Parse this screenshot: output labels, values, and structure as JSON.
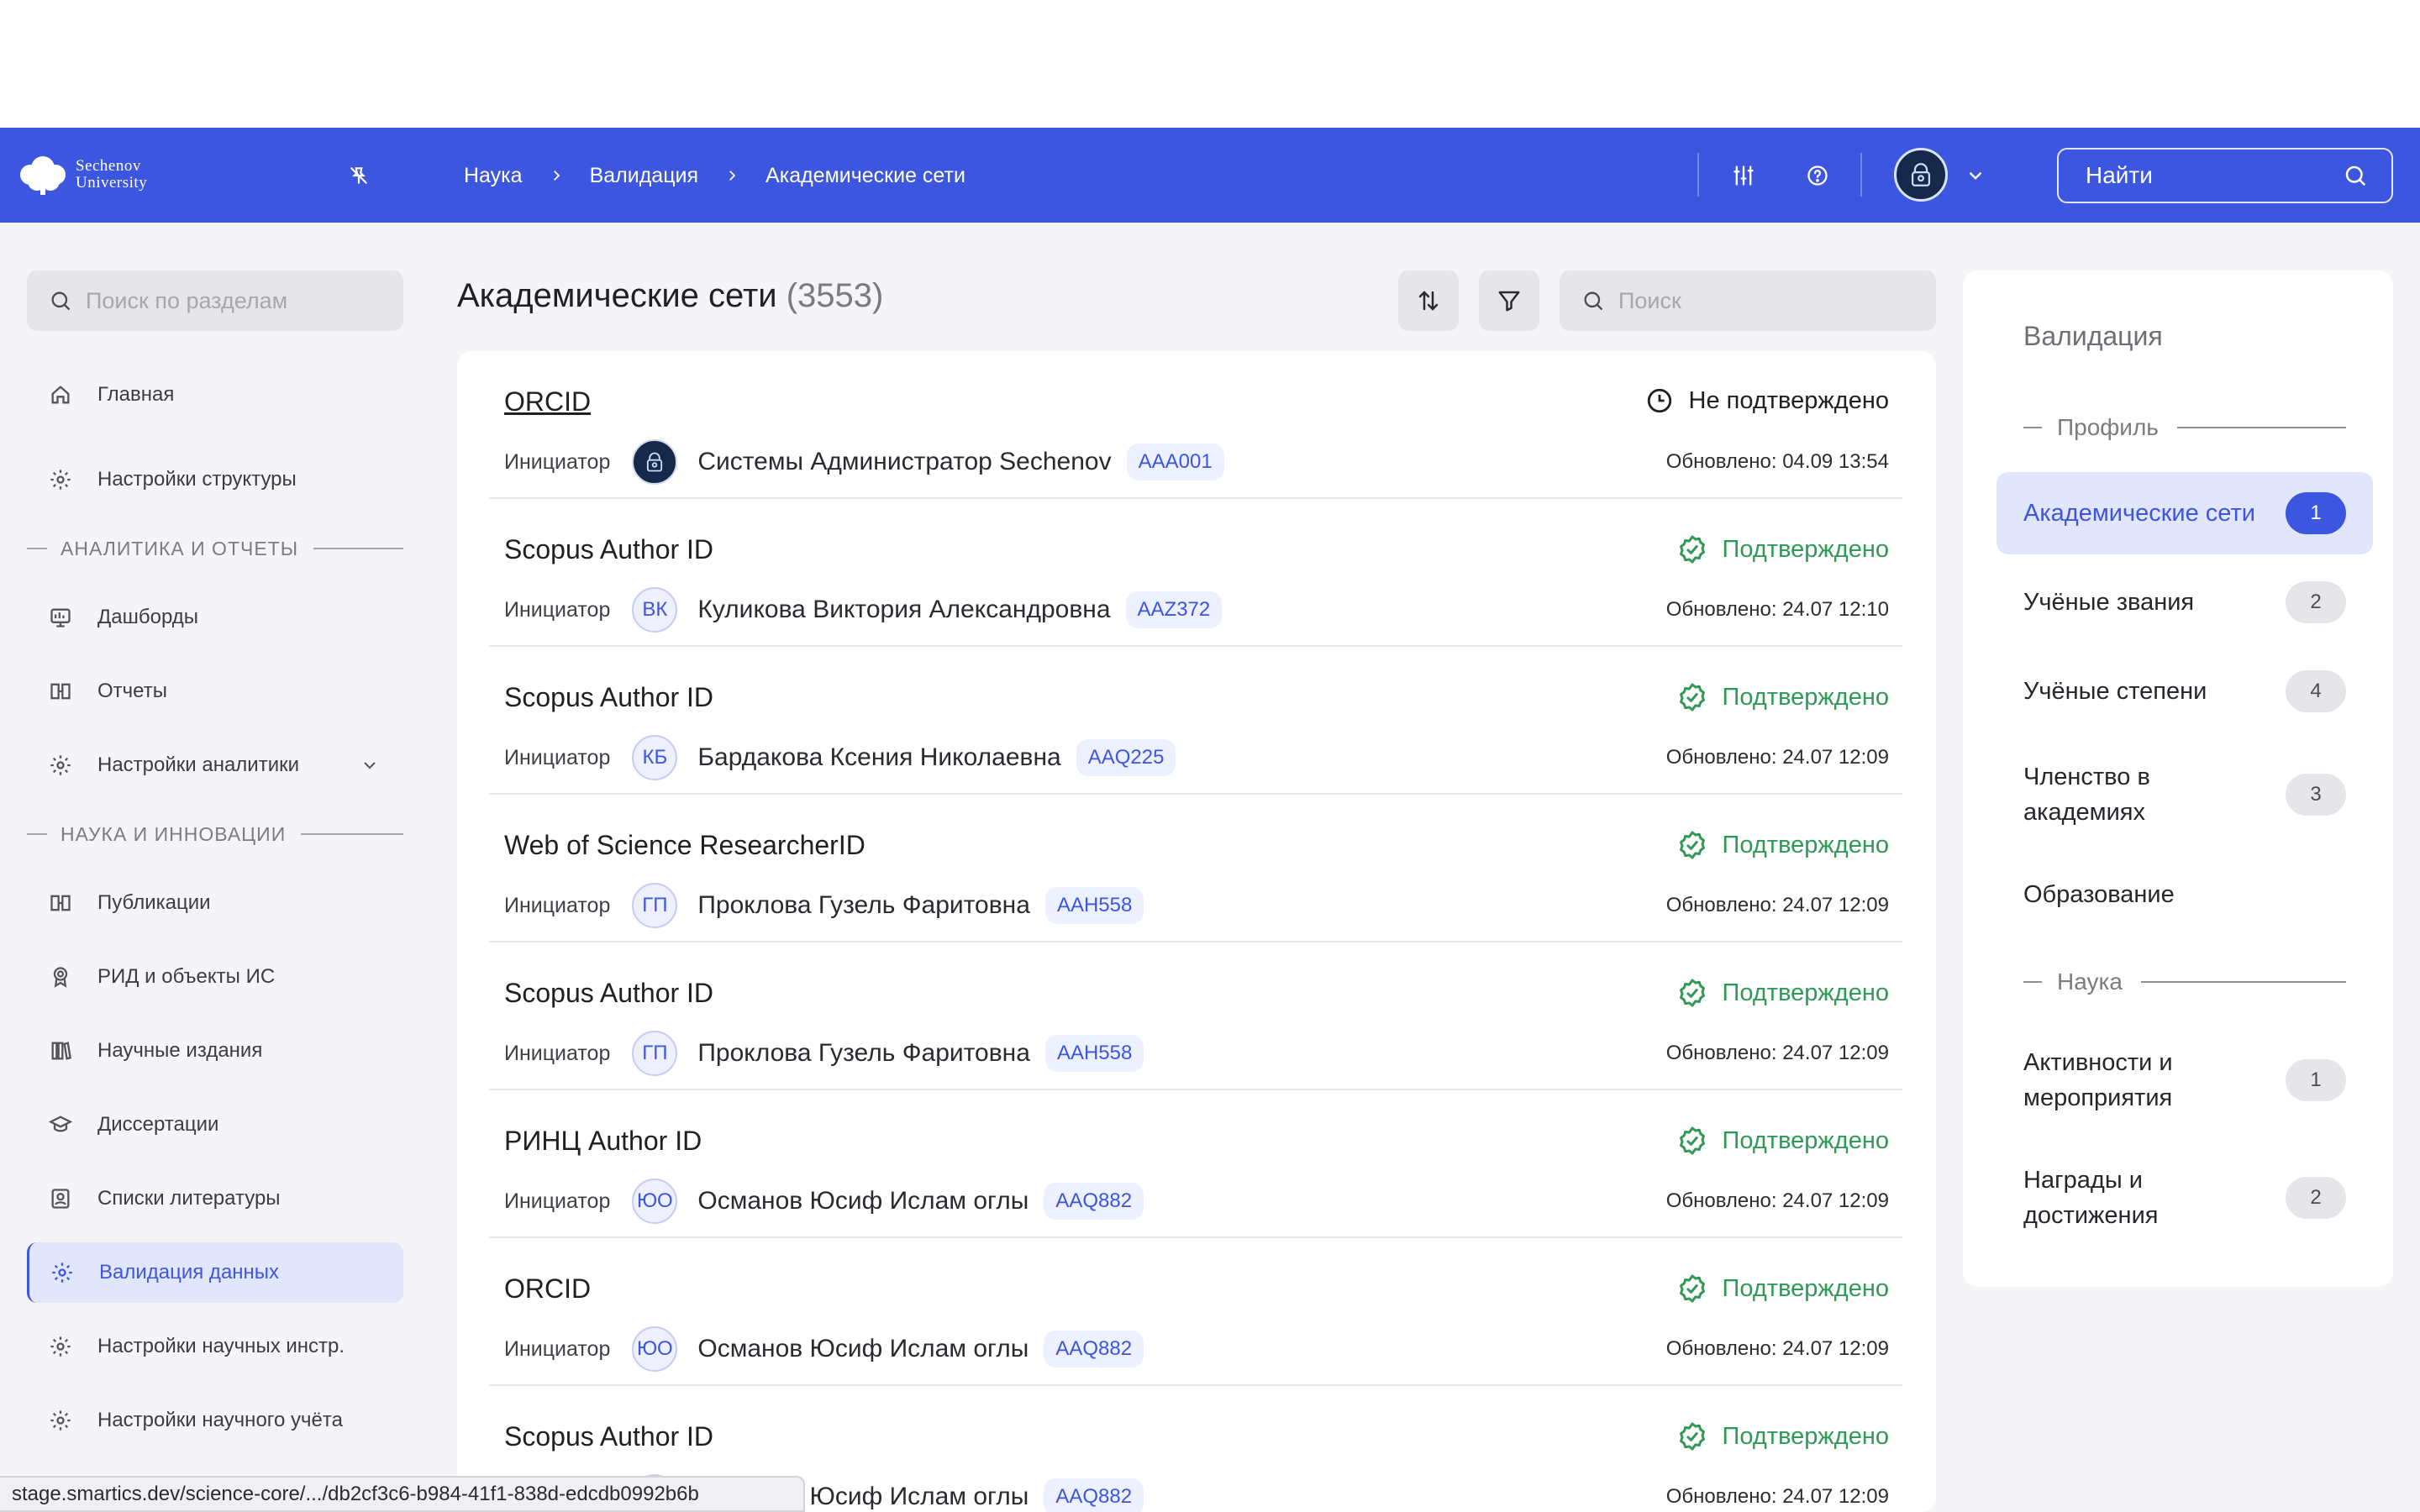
{
  "brand": {
    "line1": "Sechenov",
    "line2": "University"
  },
  "breadcrumb": [
    "Наука",
    "Валидация",
    "Академические сети"
  ],
  "header_search": {
    "label": "Найти"
  },
  "sidebar": {
    "search_placeholder": "Поиск по разделам",
    "items": {
      "home": "Главная",
      "structure": "Настройки структуры",
      "dashboards": "Дашборды",
      "reports": "Отчеты",
      "analytics_settings": "Настройки аналитики",
      "publications": "Публикации",
      "rid": "РИД и объекты ИС",
      "journals": "Научные издания",
      "dissertations": "Диссертации",
      "literature": "Списки литературы",
      "validation": "Валидация данных",
      "sci_instr": "Настройки научных инстр.",
      "sci_acc": "Настройки научного учёта"
    },
    "sections": {
      "analytics": "АНАЛИТИКА И ОТЧЕТЫ",
      "science": "НАУКА И ИННОВАЦИИ"
    }
  },
  "main": {
    "title": "Академические сети",
    "count": "(3553)",
    "search_placeholder": "Поиск",
    "initiator_label": "Инициатор",
    "rows": [
      {
        "title": "ORCID",
        "initials": "",
        "name": "Системы Администратор Sechenov",
        "code": "AAA001",
        "status": "Не подтверждено",
        "updated": "Обновлено: 04.09 13:54"
      },
      {
        "title": "Scopus Author ID",
        "initials": "ВК",
        "name": "Куликова Виктория Александровна",
        "code": "AAZ372",
        "status": "Подтверждено",
        "updated": "Обновлено: 24.07 12:10"
      },
      {
        "title": "Scopus Author ID",
        "initials": "КБ",
        "name": "Бардакова Ксения Николаевна",
        "code": "AAQ225",
        "status": "Подтверждено",
        "updated": "Обновлено: 24.07 12:09"
      },
      {
        "title": "Web of Science ResearcherID",
        "initials": "ГП",
        "name": "Проклова Гузель Фаритовна",
        "code": "AAH558",
        "status": "Подтверждено",
        "updated": "Обновлено: 24.07 12:09"
      },
      {
        "title": "Scopus Author ID",
        "initials": "ГП",
        "name": "Проклова Гузель Фаритовна",
        "code": "AAH558",
        "status": "Подтверждено",
        "updated": "Обновлено: 24.07 12:09"
      },
      {
        "title": "РИНЦ Author ID",
        "initials": "ЮО",
        "name": "Османов Юсиф Ислам оглы",
        "code": "AAQ882",
        "status": "Подтверждено",
        "updated": "Обновлено: 24.07 12:09"
      },
      {
        "title": "ORCID",
        "initials": "ЮО",
        "name": "Османов Юсиф Ислам оглы",
        "code": "AAQ882",
        "status": "Подтверждено",
        "updated": "Обновлено: 24.07 12:09"
      },
      {
        "title": "Scopus Author ID",
        "initials": "ЮО",
        "name": "Османов Юсиф Ислам оглы",
        "code": "AAQ882",
        "status": "Подтверждено",
        "updated": "Обновлено: 24.07 12:09"
      }
    ]
  },
  "right_panel": {
    "title": "Валидация",
    "section_profile": "Профиль",
    "section_science": "Наука",
    "items": [
      {
        "label": "Академические сети",
        "badge": "1"
      },
      {
        "label": "Учёные звания",
        "badge": "2"
      },
      {
        "label": "Учёные степени",
        "badge": "4"
      },
      {
        "label": "Членство в академиях",
        "badge": "3"
      },
      {
        "label": "Образование",
        "badge": ""
      },
      {
        "label": "Активности и мероприятия",
        "badge": "1"
      },
      {
        "label": "Награды и достижения",
        "badge": "2"
      }
    ]
  },
  "status_bar": {
    "url": "stage.smartics.dev/science-core/.../db2cf3c6-b984-41f1-838d-edcdb0992b6b"
  },
  "colors": {
    "primary": "#3d56df",
    "success": "#2f9a55",
    "background": "#f5f5f7"
  }
}
